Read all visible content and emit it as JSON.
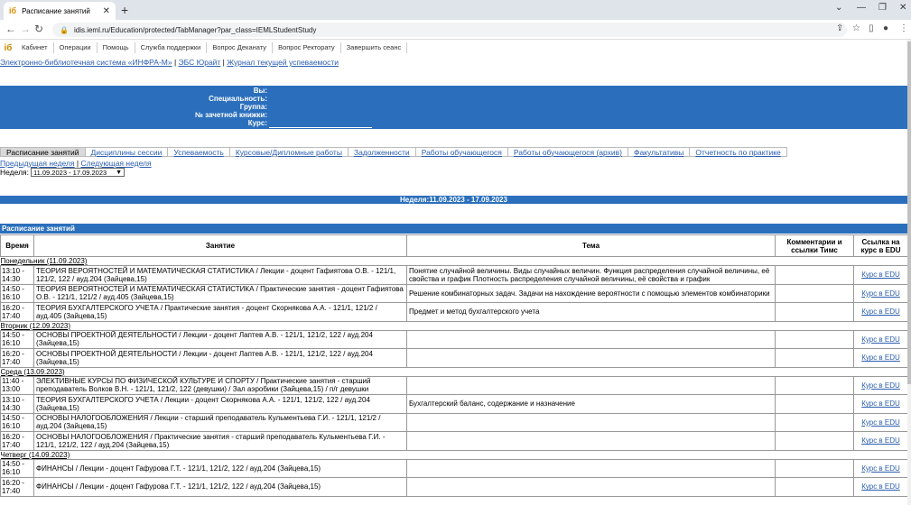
{
  "browser": {
    "tab_title": "Расписание занятий",
    "favicon": "iб",
    "url": "idis.ieml.ru/Education/protected/TabManager?par_class=IEMLStudentStudy"
  },
  "site": {
    "logo": "iб",
    "menu": [
      "Кабинет",
      "Операции",
      "Помощь",
      "Служба поддержки",
      "Вопрос Деканату",
      "Вопрос Ректорату",
      "Завершить сеанс"
    ],
    "links": {
      "l1": "Электронно-библиотечная система «ИНФРА-М»",
      "l2": "ЭБС Юрайт",
      "l3": "Журнал текущей успеваемости",
      "sep": " | "
    }
  },
  "student": {
    "you": "Вы:",
    "specialty": "Специальность:",
    "group": "Группа:",
    "record_book": "№ зачетной книжки:",
    "course": "Курс:"
  },
  "tabs": [
    "Расписание занятий",
    "Дисциплины сессии",
    "Успеваемость",
    "Курсовые/Дипломные работы",
    "Задолженности",
    "Работы обучающегося",
    "Работы обучающегося (архив)",
    "Факультативы",
    "Отчетность по практике"
  ],
  "weeknav": {
    "prev": "Предыдущая неделя",
    "sep": " | ",
    "next": "Следующая неделя"
  },
  "weeksel": {
    "label": "Неделя:",
    "value": "11.09.2023 - 17.09.2023"
  },
  "weekbar": "Неделя:11.09.2023 - 17.09.2023",
  "schedule": {
    "title": "Расписание занятий",
    "headers": {
      "time": "Время",
      "lesson": "Занятие",
      "topic": "Тема",
      "comment": "Комментарии и ссылки Тимс",
      "edu": "Ссылка на курс в EDU"
    },
    "link_text": "Курс в EDU",
    "days": [
      {
        "name": "Понедельник (11.09.2023)",
        "rows": [
          {
            "time": "13:10 - 14:30",
            "lesson": "ТЕОРИЯ ВЕРОЯТНОСТЕЙ И МАТЕМАТИЧЕСКАЯ СТАТИСТИКА / Лекции - доцент Гафиятова О.В. - 121/1, 121/2, 122 / ауд.204 (Зайцева,15)",
            "topic": "Понятие случайной величины. Виды случайных величин. Функция распределения случайной величины, её свойства и график Плотность распределения случайной величины, её свойства и график"
          },
          {
            "time": "14:50 - 16:10",
            "lesson": "ТЕОРИЯ ВЕРОЯТНОСТЕЙ И МАТЕМАТИЧЕСКАЯ СТАТИСТИКА / Практические занятия - доцент Гафиятова О.В. - 121/1, 121/2 / ауд.405 (Зайцева,15)",
            "topic": "Решение комбинаторных задач. Задачи на нахождение вероятности с помощью элементов комбинаторики"
          },
          {
            "time": "16:20 - 17:40",
            "lesson": "ТЕОРИЯ БУХГАЛТЕРСКОГО УЧЕТА / Практические занятия - доцент Скорнякова А.А. - 121/1, 121/2 / ауд.405 (Зайцева,15)",
            "topic": "Предмет и метод бухгалтерского учета"
          }
        ]
      },
      {
        "name": "Вторник (12.09.2023)",
        "rows": [
          {
            "time": "14:50 - 16:10",
            "lesson": "ОСНОВЫ ПРОЕКТНОЙ ДЕЯТЕЛЬНОСТИ / Лекции - доцент Лаптев А.В. - 121/1, 121/2, 122 / ауд.204 (Зайцева,15)",
            "topic": ""
          },
          {
            "time": "16:20 - 17:40",
            "lesson": "ОСНОВЫ ПРОЕКТНОЙ ДЕЯТЕЛЬНОСТИ / Лекции - доцент Лаптев А.В. - 121/1, 121/2, 122 / ауд.204 (Зайцева,15)",
            "topic": ""
          }
        ]
      },
      {
        "name": "Среда (13.09.2023)",
        "rows": [
          {
            "time": "11:40 - 13:00",
            "lesson": "ЭЛЕКТИВНЫЕ КУРСЫ ПО ФИЗИЧЕСКОЙ КУЛЬТУРЕ И СПОРТУ / Практические занятия - старший преподаватель Волков В.Н. - 121/1, 121/2, 122 (девушки) / Зал аэробики (Зайцева,15) / п/г девушки",
            "topic": ""
          },
          {
            "time": "13:10 - 14:30",
            "lesson": "ТЕОРИЯ БУХГАЛТЕРСКОГО УЧЕТА / Лекции - доцент Скорнякова А.А. - 121/1, 121/2, 122 / ауд.204 (Зайцева,15)",
            "topic": "Бухгалтерский баланс, содержание и назначение"
          },
          {
            "time": "14:50 - 16:10",
            "lesson": "ОСНОВЫ НАЛОГООБЛОЖЕНИЯ / Лекции - старший преподаватель Кульментьева Г.И. - 121/1, 121/2 / ауд.204 (Зайцева,15)",
            "topic": ""
          },
          {
            "time": "16:20 - 17:40",
            "lesson": "ОСНОВЫ НАЛОГООБЛОЖЕНИЯ / Практические занятия - старший преподаватель Кульментьева Г.И. - 121/1, 121/2, 122 / ауд.204 (Зайцева,15)",
            "topic": ""
          }
        ]
      },
      {
        "name": "Четверг (14.09.2023)",
        "rows": [
          {
            "time": "14:50 - 16:10",
            "lesson": "ФИНАНСЫ / Лекции - доцент Гафурова Г.Т. - 121/1, 121/2, 122 / ауд.204 (Зайцева,15)",
            "topic": ""
          },
          {
            "time": "16:20 - 17:40",
            "lesson": "ФИНАНСЫ / Лекции - доцент Гафурова Г.Т. - 121/1, 121/2, 122 / ауд.204 (Зайцева,15)",
            "topic": ""
          }
        ]
      }
    ]
  }
}
